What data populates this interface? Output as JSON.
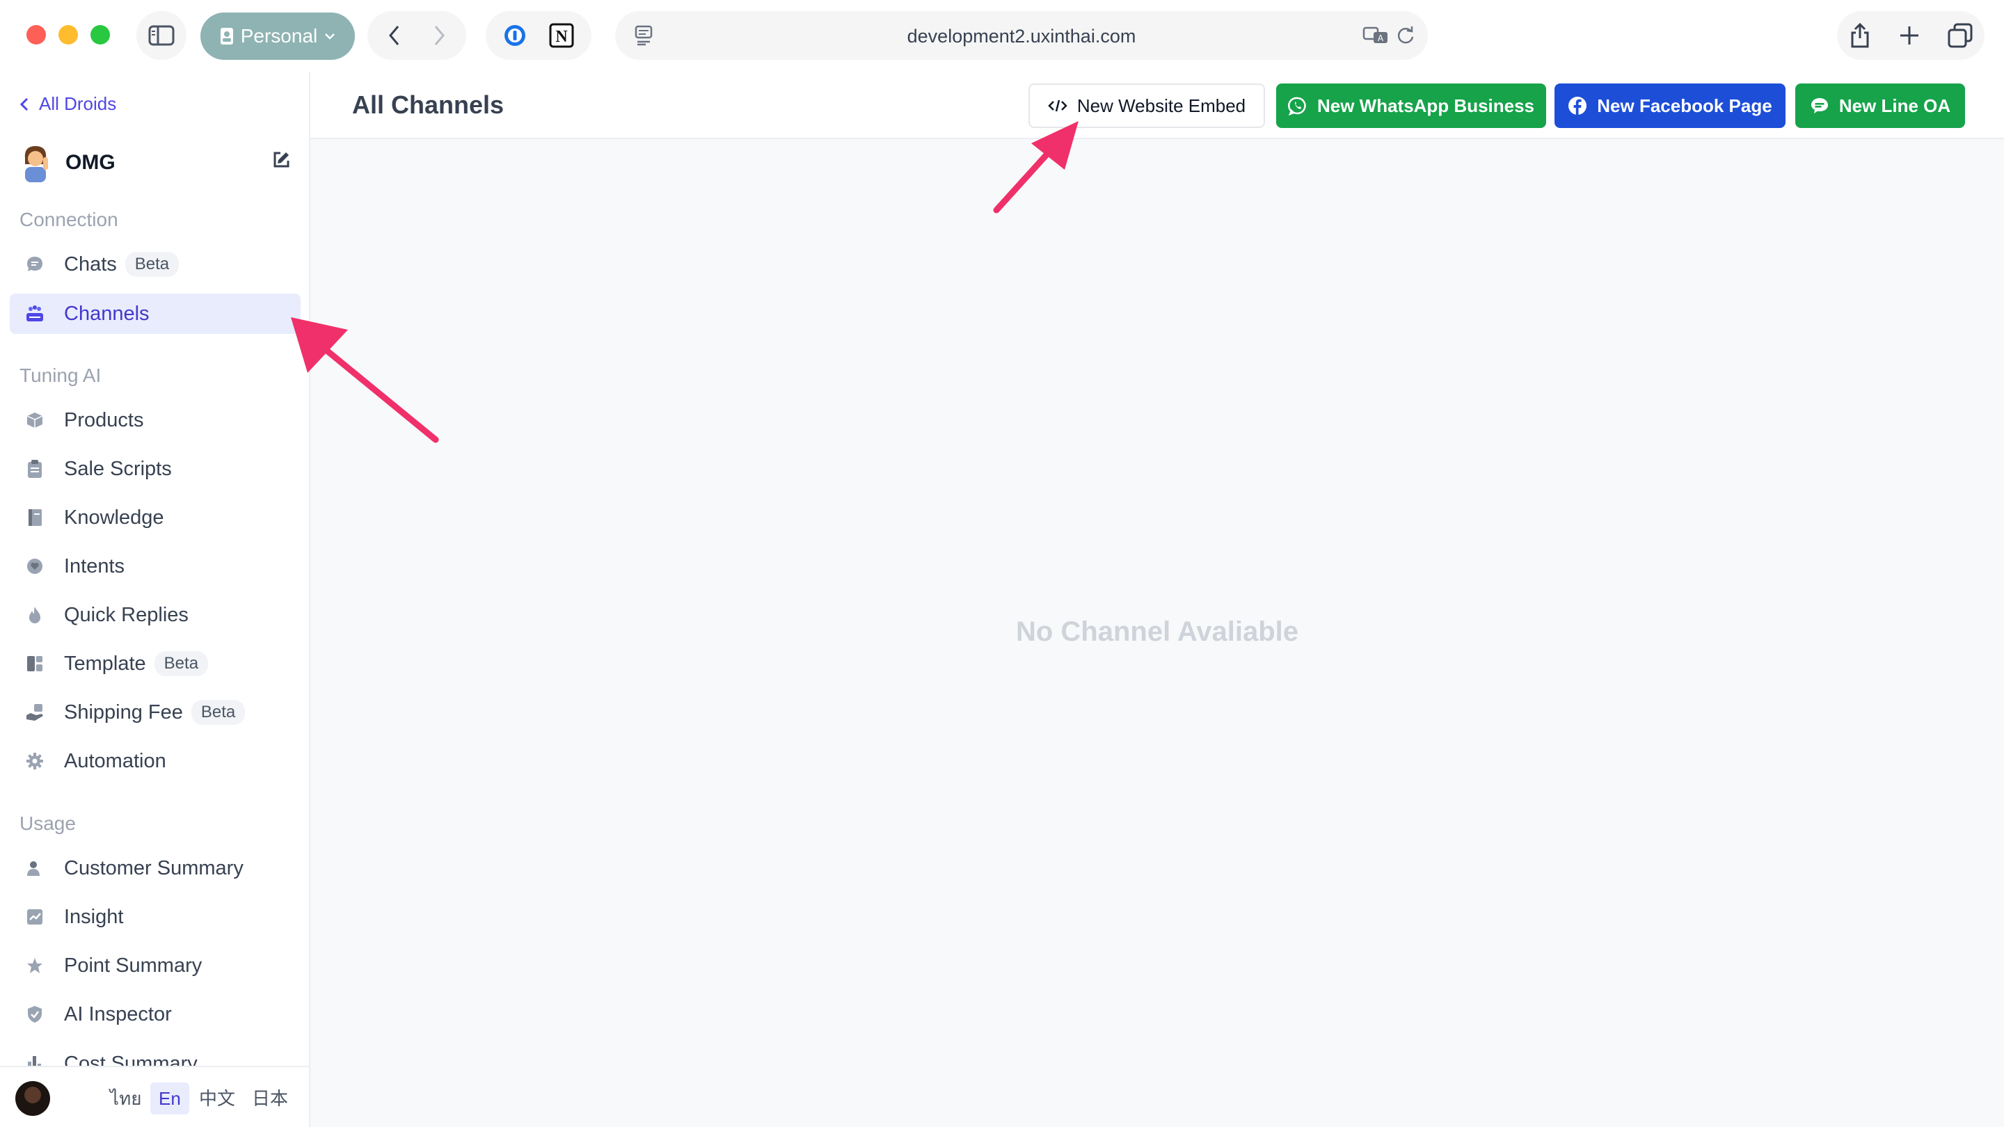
{
  "browser": {
    "profile_label": "Personal",
    "url": "development2.uxinthai.com"
  },
  "sidebar": {
    "back_label": "All Droids",
    "droid_name": "OMG",
    "sections": {
      "connection": "Connection",
      "tuning": "Tuning AI",
      "usage": "Usage"
    },
    "items": {
      "chats": {
        "label": "Chats",
        "badge": "Beta"
      },
      "channels": {
        "label": "Channels"
      },
      "products": {
        "label": "Products"
      },
      "sale_scripts": {
        "label": "Sale Scripts"
      },
      "knowledge": {
        "label": "Knowledge"
      },
      "intents": {
        "label": "Intents"
      },
      "quick_replies": {
        "label": "Quick Replies"
      },
      "template": {
        "label": "Template",
        "badge": "Beta"
      },
      "shipping_fee": {
        "label": "Shipping Fee",
        "badge": "Beta"
      },
      "automation": {
        "label": "Automation"
      },
      "customer_summary": {
        "label": "Customer Summary"
      },
      "insight": {
        "label": "Insight"
      },
      "point_summary": {
        "label": "Point Summary"
      },
      "ai_inspector": {
        "label": "AI Inspector"
      },
      "cost_summary": {
        "label": "Cost Summary"
      }
    },
    "languages": [
      "ไทย",
      "En",
      "中文",
      "日本"
    ],
    "active_language": "En"
  },
  "main": {
    "title": "All Channels",
    "buttons": {
      "website_embed": "New Website Embed",
      "whatsapp": "New WhatsApp Business",
      "facebook": "New Facebook Page",
      "line": "New Line OA"
    },
    "empty_message": "No Channel Avaliable"
  },
  "colors": {
    "accent": "#4f46e5",
    "whatsapp_green": "#16a34a",
    "facebook_blue": "#1d4ed8",
    "annotation_pink": "#f0306a"
  }
}
